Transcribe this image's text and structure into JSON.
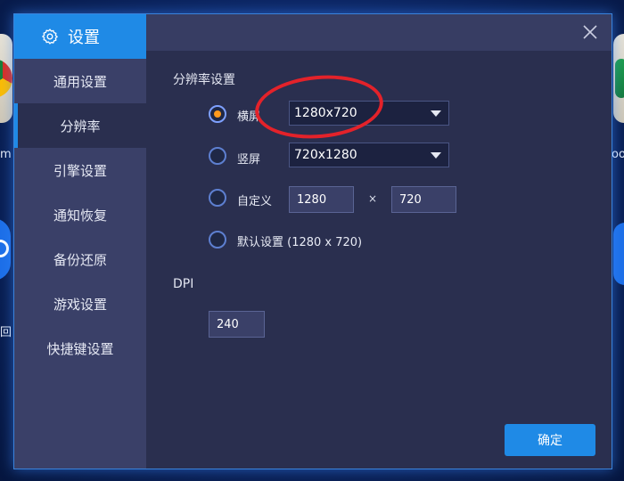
{
  "background": {
    "left_edge_letters": [
      "m",
      "回"
    ],
    "right_edge_letters": [
      "oo"
    ]
  },
  "dialog": {
    "title": "设置",
    "nav": [
      {
        "label": "通用设置",
        "active": false
      },
      {
        "label": "分辨率",
        "active": true
      },
      {
        "label": "引擎设置",
        "active": false
      },
      {
        "label": "通知恢复",
        "active": false
      },
      {
        "label": "备份还原",
        "active": false
      },
      {
        "label": "游戏设置",
        "active": false
      },
      {
        "label": "快捷键设置",
        "active": false
      }
    ],
    "resolution": {
      "section_title": "分辨率设置",
      "landscape": {
        "label": "横屏",
        "value": "1280x720",
        "checked": true
      },
      "portrait": {
        "label": "竖屏",
        "value": "720x1280",
        "checked": false
      },
      "custom": {
        "label": "自定义",
        "width": "1280",
        "times": "×",
        "height": "720",
        "checked": false
      },
      "default": {
        "label": "默认设置 (1280 x 720)",
        "checked": false
      }
    },
    "dpi": {
      "title": "DPI",
      "value": "240"
    },
    "confirm_label": "确定"
  },
  "colors": {
    "accent": "#1f8ae6",
    "radio_dot": "#ff9a1d",
    "annotation_ring": "#e3222a"
  }
}
